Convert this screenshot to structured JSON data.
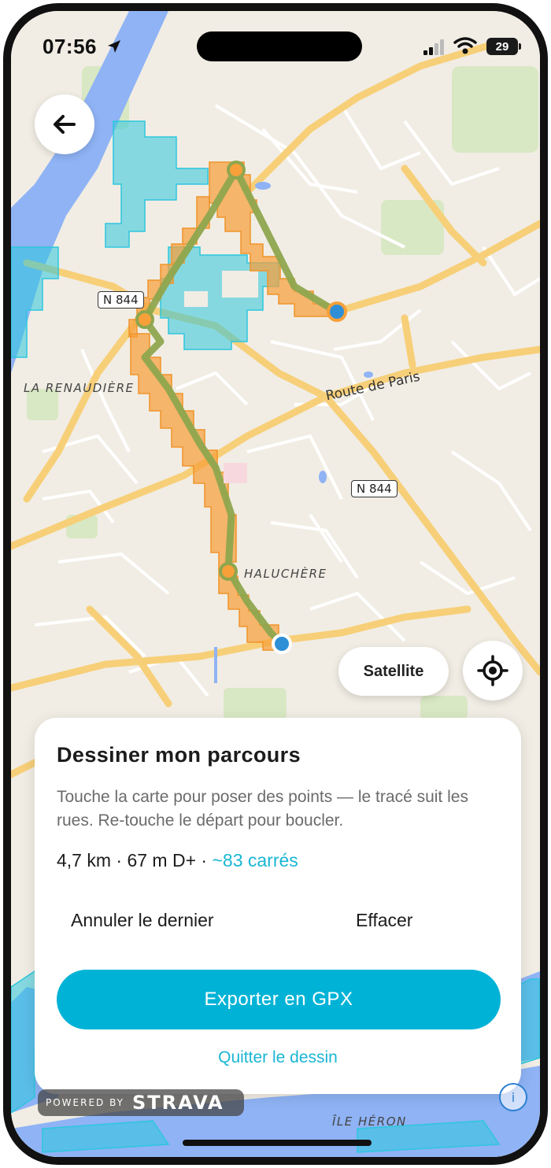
{
  "status_bar": {
    "time": "07:56",
    "battery": "29"
  },
  "map": {
    "labels": {
      "la_renaudiere": "LA RENAUDIÈRE",
      "haluchere": "HALUCHÈRE",
      "ile_heron": "ÎLE HÉRON",
      "route_de_paris": "Route de Paris"
    },
    "road_shields": {
      "n844_left": "N 844",
      "n844_right": "N 844"
    },
    "colors": {
      "land": "#f1ede4",
      "water": "#8fb3f5",
      "road": "#f7cf78",
      "route_line": "#8ea64e",
      "tile_orange": "#f7a03a",
      "tile_cyan": "#2ec6dd"
    }
  },
  "buttons": {
    "back": "back-arrow-icon",
    "satellite": "Satellite",
    "locate": "crosshair-icon"
  },
  "card": {
    "title": "Dessiner mon parcours",
    "description": "Touche la carte pour poser des points — le tracé suit les rues. Re-touche le départ pour boucler.",
    "stats_prefix": "4,7 km · 67 m D+ · ",
    "stats_squares": "~83 carrés",
    "undo_label": "Annuler le dernier",
    "clear_label": "Effacer",
    "export_label": "Exporter en GPX",
    "quit_label": "Quitter le dessin",
    "accent": "#00b3d6"
  },
  "footer": {
    "powered_by": "POWERED BY",
    "brand": "STRAVA"
  }
}
